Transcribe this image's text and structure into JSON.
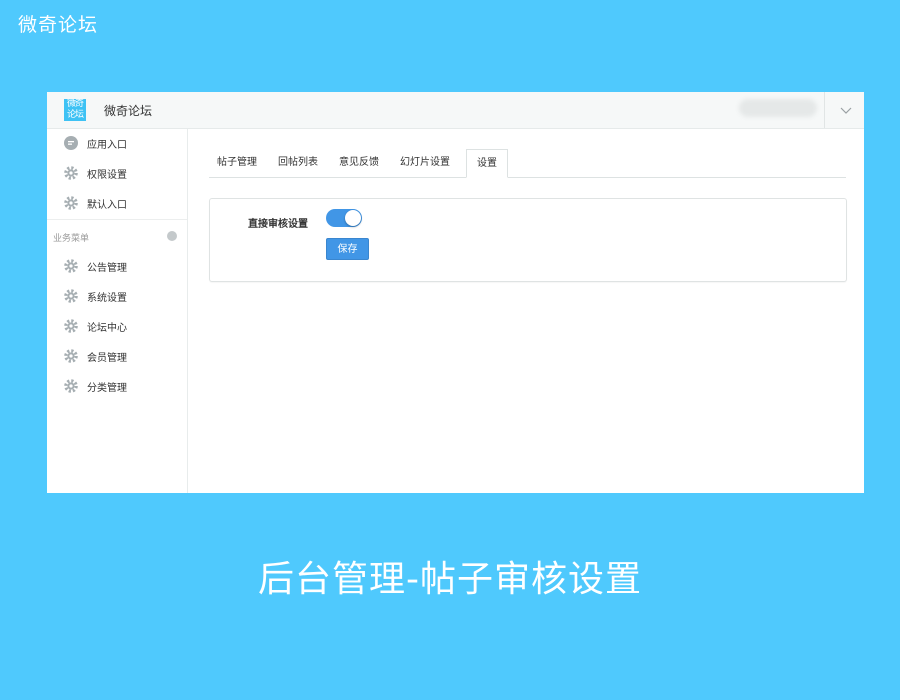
{
  "banner": {
    "title": "微奇论坛"
  },
  "caption": "后台管理-帖子审核设置",
  "app": {
    "logo_text": "微奇论坛",
    "name": "微奇论坛"
  },
  "sidebar": {
    "items": [
      {
        "label": "应用入口",
        "icon": "chat-bubble-icon"
      },
      {
        "label": "权限设置",
        "icon": "gear-icon"
      },
      {
        "label": "默认入口",
        "icon": "gear-icon"
      }
    ],
    "group_label": "业务菜单",
    "group_items": [
      {
        "label": "公告管理",
        "icon": "gear-icon"
      },
      {
        "label": "系统设置",
        "icon": "gear-icon"
      },
      {
        "label": "论坛中心",
        "icon": "gear-icon"
      },
      {
        "label": "会员管理",
        "icon": "gear-icon"
      },
      {
        "label": "分类管理",
        "icon": "gear-icon"
      }
    ]
  },
  "tabs": [
    {
      "label": "帖子管理",
      "active": false
    },
    {
      "label": "回帖列表",
      "active": false
    },
    {
      "label": "意见反馈",
      "active": false
    },
    {
      "label": "幻灯片设置",
      "active": false
    },
    {
      "label": "设置",
      "active": true
    }
  ],
  "settings": {
    "direct_review_label": "直接审核设置",
    "direct_review_enabled": true,
    "save_label": "保存"
  },
  "colors": {
    "background": "#4fc9fd",
    "accent": "#4196e6",
    "logo": "#3ec2f4"
  }
}
